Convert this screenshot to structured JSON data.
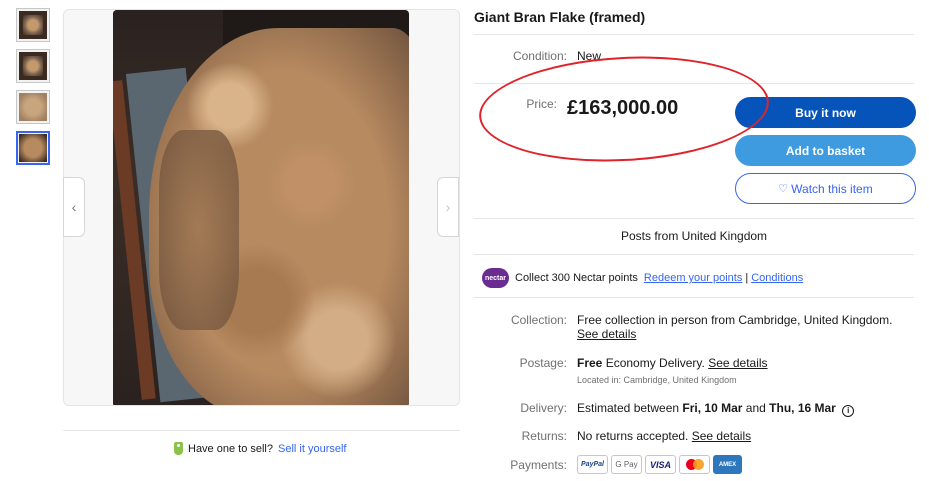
{
  "listing": {
    "title": "Giant Bran Flake (framed)",
    "condition_label": "Condition:",
    "condition_value": "New",
    "price_label": "Price:",
    "price_value": "£163,000.00"
  },
  "actions": {
    "buy_now": "Buy it now",
    "add_to_basket": "Add to basket",
    "watch": "Watch this item"
  },
  "gallery": {
    "thumbnail_count": 4,
    "active_index": 3,
    "prev_icon": "chevron-left-icon",
    "next_icon": "chevron-right-icon"
  },
  "sell": {
    "prompt": "Have one to sell?",
    "link": "Sell it yourself"
  },
  "posts_from": "Posts from United Kingdom",
  "nectar": {
    "logo_text": "nectar",
    "text": "Collect 300 Nectar points",
    "redeem_link": "Redeem your points",
    "separator": "|",
    "conditions_link": "Conditions"
  },
  "shipping": {
    "collection_label": "Collection:",
    "collection_value": "Free collection in person from Cambridge, United Kingdom.",
    "collection_link": "See details",
    "postage_label": "Postage:",
    "postage_free": "Free",
    "postage_value": "Economy Delivery.",
    "postage_link": "See details",
    "postage_location": "Located in: Cambridge, United Kingdom",
    "delivery_label": "Delivery:",
    "delivery_prefix": "Estimated between",
    "delivery_start": "Fri, 10 Mar",
    "delivery_and": "and",
    "delivery_end": "Thu, 16 Mar",
    "returns_label": "Returns:",
    "returns_value": "No returns accepted.",
    "returns_link": "See details",
    "payments_label": "Payments:"
  },
  "payments": {
    "paypal": "PayPal",
    "gpay": "G Pay",
    "visa": "VISA",
    "amex": "AMEX"
  },
  "colors": {
    "annotation_circle": "#e0232a",
    "buy_button": "#0654ba",
    "basket_button": "#3f9be0",
    "link": "#3665f3"
  }
}
